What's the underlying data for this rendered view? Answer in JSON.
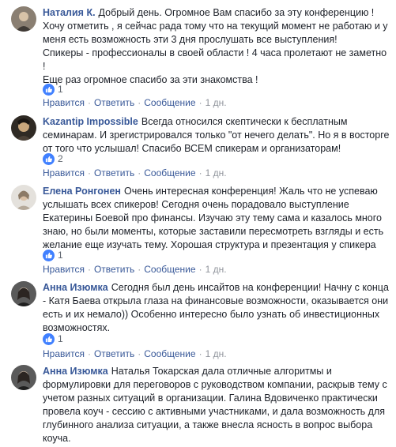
{
  "comments": [
    {
      "author": "Наталия К.",
      "lines": [
        "Добрый день. Огромное Вам спасибо за эту конференцию !",
        "Хочу отметить , я сейчас рада тому что на текущий момент не работаю и у",
        "меня есть возможность эти 3 дня прослушать все выступления!",
        "Спикеры - профессионалы в своей области ! 4 часа пролетают не заметно",
        "!",
        "Еще раз огромное спасибо за эти знакомства !"
      ],
      "likes": "1",
      "actions": {
        "like": "Нравится",
        "reply": "Ответить",
        "message": "Сообщение",
        "time": "1 дн."
      }
    },
    {
      "author": "Kazantip Impossible",
      "lines": [
        "Всегда относился скептически к бесплатным",
        "семинарам. И зрегистрировался только \"от нечего делать\". Но я в восторге",
        "от того что услышал! Спасибо ВСЕМ спикерам и организаторам!"
      ],
      "likes": "2",
      "actions": {
        "like": "Нравится",
        "reply": "Ответить",
        "message": "Сообщение",
        "time": "1 дн."
      }
    },
    {
      "author": "Елена Ронгонен",
      "lines": [
        "Очень интересная конференция! Жаль что не успеваю",
        "услышать всех спикеров! Сегодня очень порадовало выступление",
        "Екатерины Боевой про финансы. Изучаю эту тему сама и казалось много",
        "знаю, но были моменты, которые заставили пересмотреть взгляды и есть",
        "желание еще изучать тему. Хорошая структура и презентация у спикера"
      ],
      "likes": "1",
      "actions": {
        "like": "Нравится",
        "reply": "Ответить",
        "message": "Сообщение",
        "time": "1 дн."
      }
    },
    {
      "author": "Анна Изюмка",
      "lines": [
        "Сегодня был день инсайтов на конференции! Начну с конца",
        "- Катя Баева открыла глаза на финансовые возможности, оказывается они",
        "есть и их немало)) Особенно интересно было узнать об инвестиционных",
        "возможностях."
      ],
      "likes": "1",
      "actions": {
        "like": "Нравится",
        "reply": "Ответить",
        "message": "Сообщение",
        "time": "1 дн."
      }
    },
    {
      "author": "Анна Изюмка",
      "lines": [
        "Наталья Токарская дала отличные алгоритмы и",
        "формулировки для переговоров с руководством компании, раскрыв тему с",
        "учетом разных ситуаций в организации. Галина Вдовиченко практически",
        "провела коуч - сессию с активными участниками, и дала возможность для",
        "глубинного анализа ситуации, а также внесла ясность в вопрос выбора",
        "коуча."
      ]
    }
  ],
  "icons": {
    "like": "thumbs-up-icon"
  },
  "colors": {
    "author": "#385898",
    "like_badge": "#4080ff",
    "text": "#1d2129",
    "meta": "#90949c"
  }
}
